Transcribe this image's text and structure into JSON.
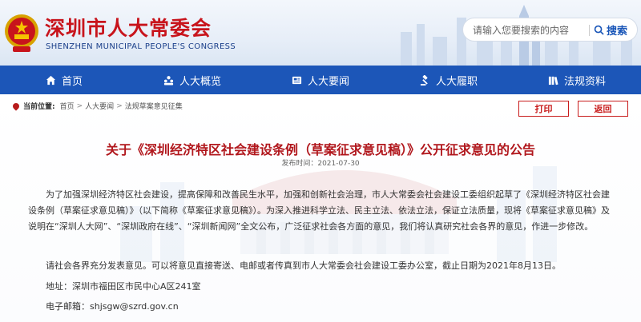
{
  "header": {
    "title": "深圳市人大常委会",
    "subtitle": "SHENZHEN MUNICIPAL PEOPLE'S CONGRESS",
    "emblem_icon": "national-emblem-icon",
    "search": {
      "placeholder": "请输入您要搜索的内容",
      "button_label": "搜索",
      "icon": "search-icon"
    },
    "colors": {
      "title": "#c8141c",
      "subtitle": "#1a3f8a"
    }
  },
  "nav": {
    "items": [
      {
        "label": "首页",
        "icon": "home-icon"
      },
      {
        "label": "人大概览",
        "icon": "people-icon"
      },
      {
        "label": "人大要闻",
        "icon": "newspaper-icon"
      },
      {
        "label": "人大履职",
        "icon": "gavel-icon"
      },
      {
        "label": "法规资料",
        "icon": "books-icon"
      }
    ],
    "background": "#1c56b8"
  },
  "breadcrumb": {
    "label": "当前位置:",
    "items": [
      "首页",
      "人大要闻",
      "法规草案意见征集"
    ],
    "separator": ">"
  },
  "actions": {
    "print_label": "打印",
    "back_label": "返回",
    "color": "#c81b1b"
  },
  "article": {
    "title": "关于《深圳经济特区社会建设条例（草案征求意见稿）》公开征求意见的公告",
    "date": "发布时间：2021-07-30",
    "paragraphs": [
      "为了加强深圳经济特区社会建设，提高保障和改善民生水平，加强和创新社会治理，市人大常委会社会建设工委组织起草了《深圳经济特区社会建设条例（草案征求意见稿）》（以下简称《草案征求意见稿》）。为深入推进科学立法、民主立法、依法立法，保证立法质量，现将《草案征求意见稿》及说明在“深圳人大网”、“深圳政府在线”、“深圳新闻网”全文公布，广泛征求社会各方面的意见，我们将认真研究社会各界的意见，作进一步修改。",
      "请社会各界充分发表意见。可以将意见直接寄送、电邮或者传真到市人大常委会社会建设工委办公室，截止日期为2021年8月13日。",
      "地址：深圳市福田区市民中心A区241室",
      "电子邮箱：shjsgw@szrd.gov.cn"
    ],
    "title_color": "#b1171d"
  }
}
